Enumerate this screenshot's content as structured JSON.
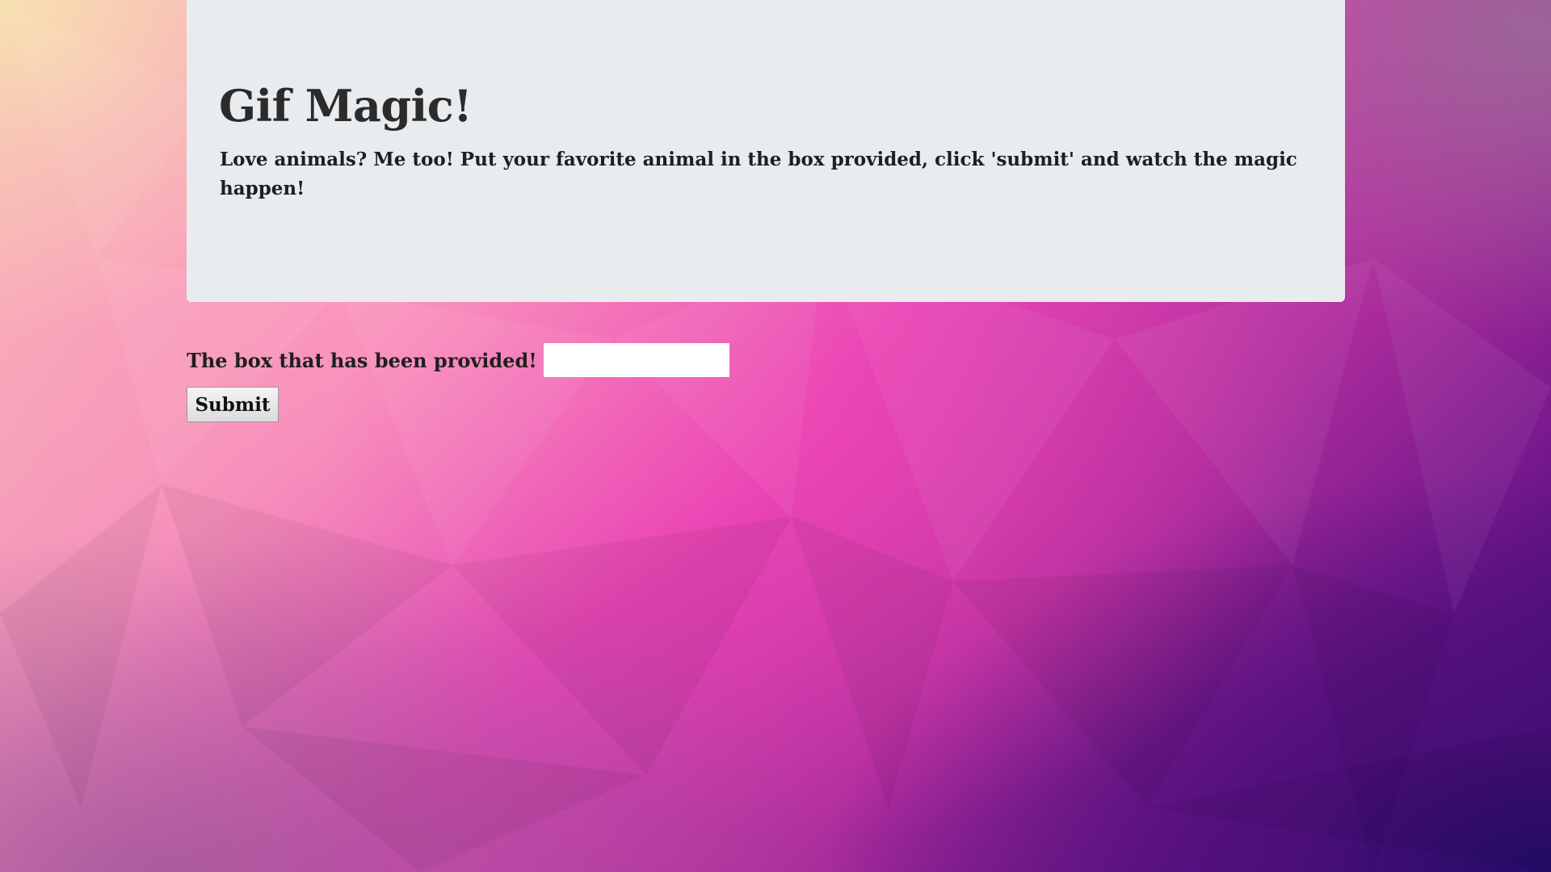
{
  "hero": {
    "title": "Gif Magic!",
    "lead": "Love animals? Me too! Put your favorite animal in the box provided, click 'submit' and watch the magic happen!"
  },
  "form": {
    "label": "The box that has been provided!",
    "input_value": "",
    "input_placeholder": "",
    "submit_label": "Submit"
  },
  "colors": {
    "jumbotron_bg": "#e9ecef",
    "text": "#1f1f1f",
    "background_top_left": "#f8e2b0",
    "background_center": "#e345b5",
    "background_bottom_right": "#240c68"
  }
}
